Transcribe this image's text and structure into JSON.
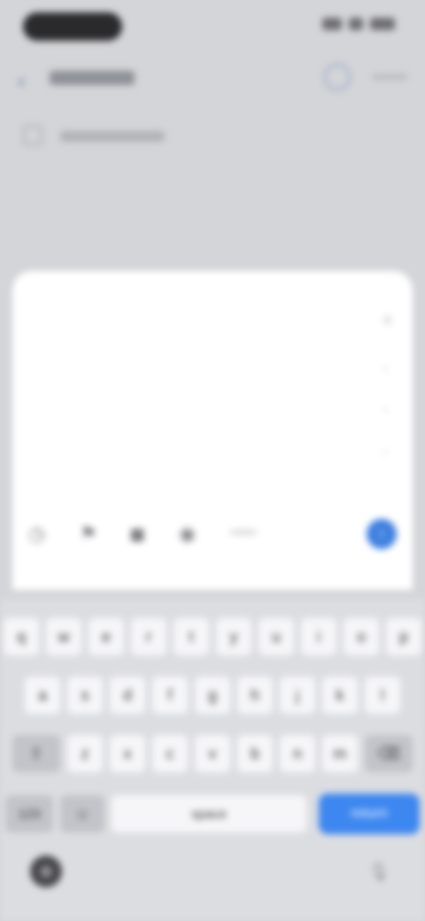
{
  "status_bar": {
    "time": ""
  },
  "sheet": {
    "title": "",
    "close_icon": "close-icon",
    "fields": [
      {
        "label": "",
        "value": ""
      },
      {
        "label": "",
        "value": ""
      },
      {
        "label": "",
        "value": ""
      }
    ],
    "send_icon": "arrow-up-icon"
  },
  "keyboard": {
    "row1": [
      "q",
      "w",
      "e",
      "r",
      "t",
      "y",
      "u",
      "i",
      "o",
      "p"
    ],
    "row2": [
      "a",
      "s",
      "d",
      "f",
      "g",
      "h",
      "j",
      "k",
      "l"
    ],
    "row3": [
      "z",
      "x",
      "c",
      "v",
      "b",
      "n",
      "m"
    ],
    "mode_label": "123",
    "space_label": "space",
    "return_label": "return"
  },
  "colors": {
    "accent": "#3d87f0",
    "sheet_bg": "#ffffff",
    "keyboard_bg": "#dcdde1"
  }
}
